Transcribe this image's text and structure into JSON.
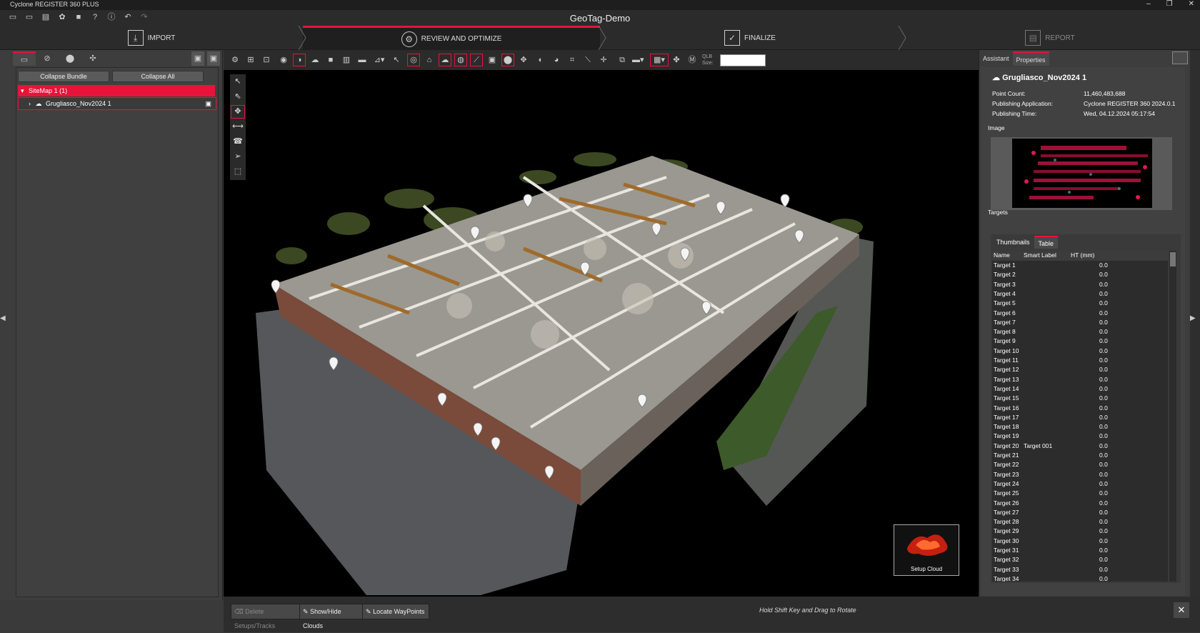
{
  "app": {
    "title": "Cyclone REGISTER 360 PLUS",
    "project_title": "GeoTag-Demo"
  },
  "workflow": {
    "steps": [
      {
        "label": "IMPORT",
        "state": "normal"
      },
      {
        "label": "REVIEW AND OPTIMIZE",
        "state": "active"
      },
      {
        "label": "FINALIZE",
        "state": "normal"
      },
      {
        "label": "REPORT",
        "state": "dim"
      }
    ]
  },
  "left_panel": {
    "collapse_bundle_label": "Collapse Bundle",
    "collapse_all_label": "Collapse All",
    "tree": {
      "sitemap_label": "SiteMap 1 (1)",
      "child_label": "Grugliasco_Nov2024 1"
    }
  },
  "toolbar": {
    "qlb_size_label": "QLB Size:",
    "qlb_size_value": ""
  },
  "viewport": {
    "setup_cloud_label": "Setup Cloud"
  },
  "bottom": {
    "delete_label": "Delete Setups/Tracks",
    "show_hide_label": "Show/Hide Clouds",
    "locate_label": "Locate WayPoints",
    "hint": "Hold Shift Key and Drag to Rotate"
  },
  "right_panel": {
    "tabs": [
      "Assistant",
      "Properties"
    ],
    "active_tab": "Properties",
    "cloud_name": "Grugliasco_Nov2024 1",
    "properties": [
      {
        "key": "Point Count:",
        "value": "11,460,483,688"
      },
      {
        "key": "Publishing Application:",
        "value": "Cyclone REGISTER 360 2024.0.1"
      },
      {
        "key": "Publishing Time:",
        "value": "Wed, 04.12.2024 05:17:54"
      }
    ],
    "image_label": "Image",
    "targets_label": "Targets",
    "target_tabs": [
      "Thumbnails",
      "Table"
    ],
    "columns": [
      "Name",
      "Smart Label",
      "HT (mm)"
    ],
    "rows": [
      {
        "name": "Target 1",
        "label": "",
        "ht": "0.0"
      },
      {
        "name": "Target 2",
        "label": "",
        "ht": "0.0"
      },
      {
        "name": "Target 3",
        "label": "",
        "ht": "0.0"
      },
      {
        "name": "Target 4",
        "label": "",
        "ht": "0.0"
      },
      {
        "name": "Target 5",
        "label": "",
        "ht": "0.0"
      },
      {
        "name": "Target 6",
        "label": "",
        "ht": "0.0"
      },
      {
        "name": "Target 7",
        "label": "",
        "ht": "0.0"
      },
      {
        "name": "Target 8",
        "label": "",
        "ht": "0.0"
      },
      {
        "name": "Target 9",
        "label": "",
        "ht": "0.0"
      },
      {
        "name": "Target 10",
        "label": "",
        "ht": "0.0"
      },
      {
        "name": "Target 11",
        "label": "",
        "ht": "0.0"
      },
      {
        "name": "Target 12",
        "label": "",
        "ht": "0.0"
      },
      {
        "name": "Target 13",
        "label": "",
        "ht": "0.0"
      },
      {
        "name": "Target 14",
        "label": "",
        "ht": "0.0"
      },
      {
        "name": "Target 15",
        "label": "",
        "ht": "0.0"
      },
      {
        "name": "Target 16",
        "label": "",
        "ht": "0.0"
      },
      {
        "name": "Target 17",
        "label": "",
        "ht": "0.0"
      },
      {
        "name": "Target 18",
        "label": "",
        "ht": "0.0"
      },
      {
        "name": "Target 19",
        "label": "",
        "ht": "0.0"
      },
      {
        "name": "Target 20",
        "label": "Target 001",
        "ht": "0.0"
      },
      {
        "name": "Target 21",
        "label": "",
        "ht": "0.0"
      },
      {
        "name": "Target 22",
        "label": "",
        "ht": "0.0"
      },
      {
        "name": "Target 23",
        "label": "",
        "ht": "0.0"
      },
      {
        "name": "Target 24",
        "label": "",
        "ht": "0.0"
      },
      {
        "name": "Target 25",
        "label": "",
        "ht": "0.0"
      },
      {
        "name": "Target 26",
        "label": "",
        "ht": "0.0"
      },
      {
        "name": "Target 27",
        "label": "",
        "ht": "0.0"
      },
      {
        "name": "Target 28",
        "label": "",
        "ht": "0.0"
      },
      {
        "name": "Target 29",
        "label": "",
        "ht": "0.0"
      },
      {
        "name": "Target 30",
        "label": "",
        "ht": "0.0"
      },
      {
        "name": "Target 31",
        "label": "",
        "ht": "0.0"
      },
      {
        "name": "Target 32",
        "label": "",
        "ht": "0.0"
      },
      {
        "name": "Target 33",
        "label": "",
        "ht": "0.0"
      },
      {
        "name": "Target 34",
        "label": "",
        "ht": "0.0"
      }
    ]
  },
  "colors": {
    "accent": "#e8133a",
    "background": "#3a3a3a",
    "viewport": "#000000"
  }
}
